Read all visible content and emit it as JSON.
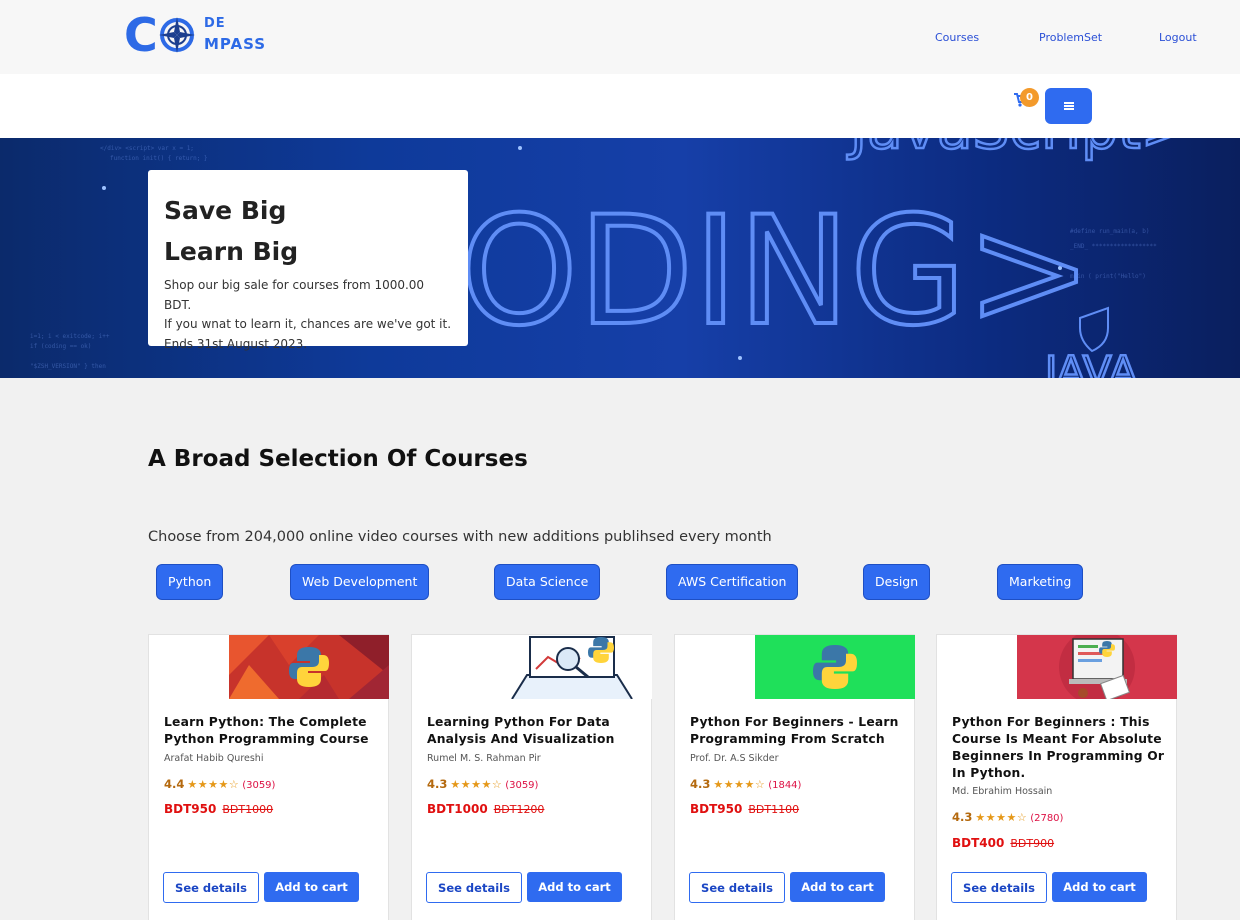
{
  "brand": {
    "logo_text_c": "C",
    "logo_text_de": "DE",
    "logo_text_mpass": "MPASS",
    "accent": "#2f6bf0"
  },
  "nav": {
    "links": [
      "Courses",
      "ProblemSet",
      "Logout"
    ]
  },
  "cart": {
    "count": "0",
    "icon": "cart-icon"
  },
  "menu": {
    "icon": "hamburger-icon"
  },
  "hero": {
    "line1": "Save Big",
    "line2": "Learn Big",
    "text1": "Shop our big sale for courses from 1000.00 BDT.",
    "text2": "If you wnat to learn it, chances are we've got it.",
    "text3": "Ends 31st August 2023.",
    "bg_word": "ODING>"
  },
  "section": {
    "title": "A Broad Selection Of Courses",
    "subtitle": "Choose from 204,000 online video courses with new additions publihsed every month",
    "categories": [
      "Python",
      "Web Development",
      "Data Science",
      "AWS Certification",
      "Design",
      "Marketing"
    ]
  },
  "courses": [
    {
      "title": "Learn Python: The Complete Python Programming Course",
      "instructor": "Arafat Habib Qureshi",
      "rating": "4.4",
      "stars": "★★★★☆",
      "reviews": "(3059)",
      "price": "BDT950",
      "old_price": "BDT1000",
      "details_label": "See details",
      "cart_label": "Add to cart"
    },
    {
      "title": "Learning Python For Data Analysis And Visualization",
      "instructor": "Rumel M. S. Rahman Pir",
      "rating": "4.3",
      "stars": "★★★★☆",
      "reviews": "(3059)",
      "price": "BDT1000",
      "old_price": "BDT1200",
      "details_label": "See details",
      "cart_label": "Add to cart"
    },
    {
      "title": "Python For Beginners - Learn Programming From Scratch",
      "instructor": "Prof. Dr. A.S Sikder",
      "rating": "4.3",
      "stars": "★★★★☆",
      "reviews": "(1844)",
      "price": "BDT950",
      "old_price": "BDT1100",
      "details_label": "See details",
      "cart_label": "Add to cart"
    },
    {
      "title": "Python For Beginners : This Course Is Meant For Absolute Beginners In Programming Or In Python.",
      "instructor": "Md. Ebrahim Hossain",
      "rating": "4.3",
      "stars": "★★★★☆",
      "reviews": "(2780)",
      "price": "BDT400",
      "old_price": "BDT900",
      "details_label": "See details",
      "cart_label": "Add to cart"
    }
  ]
}
